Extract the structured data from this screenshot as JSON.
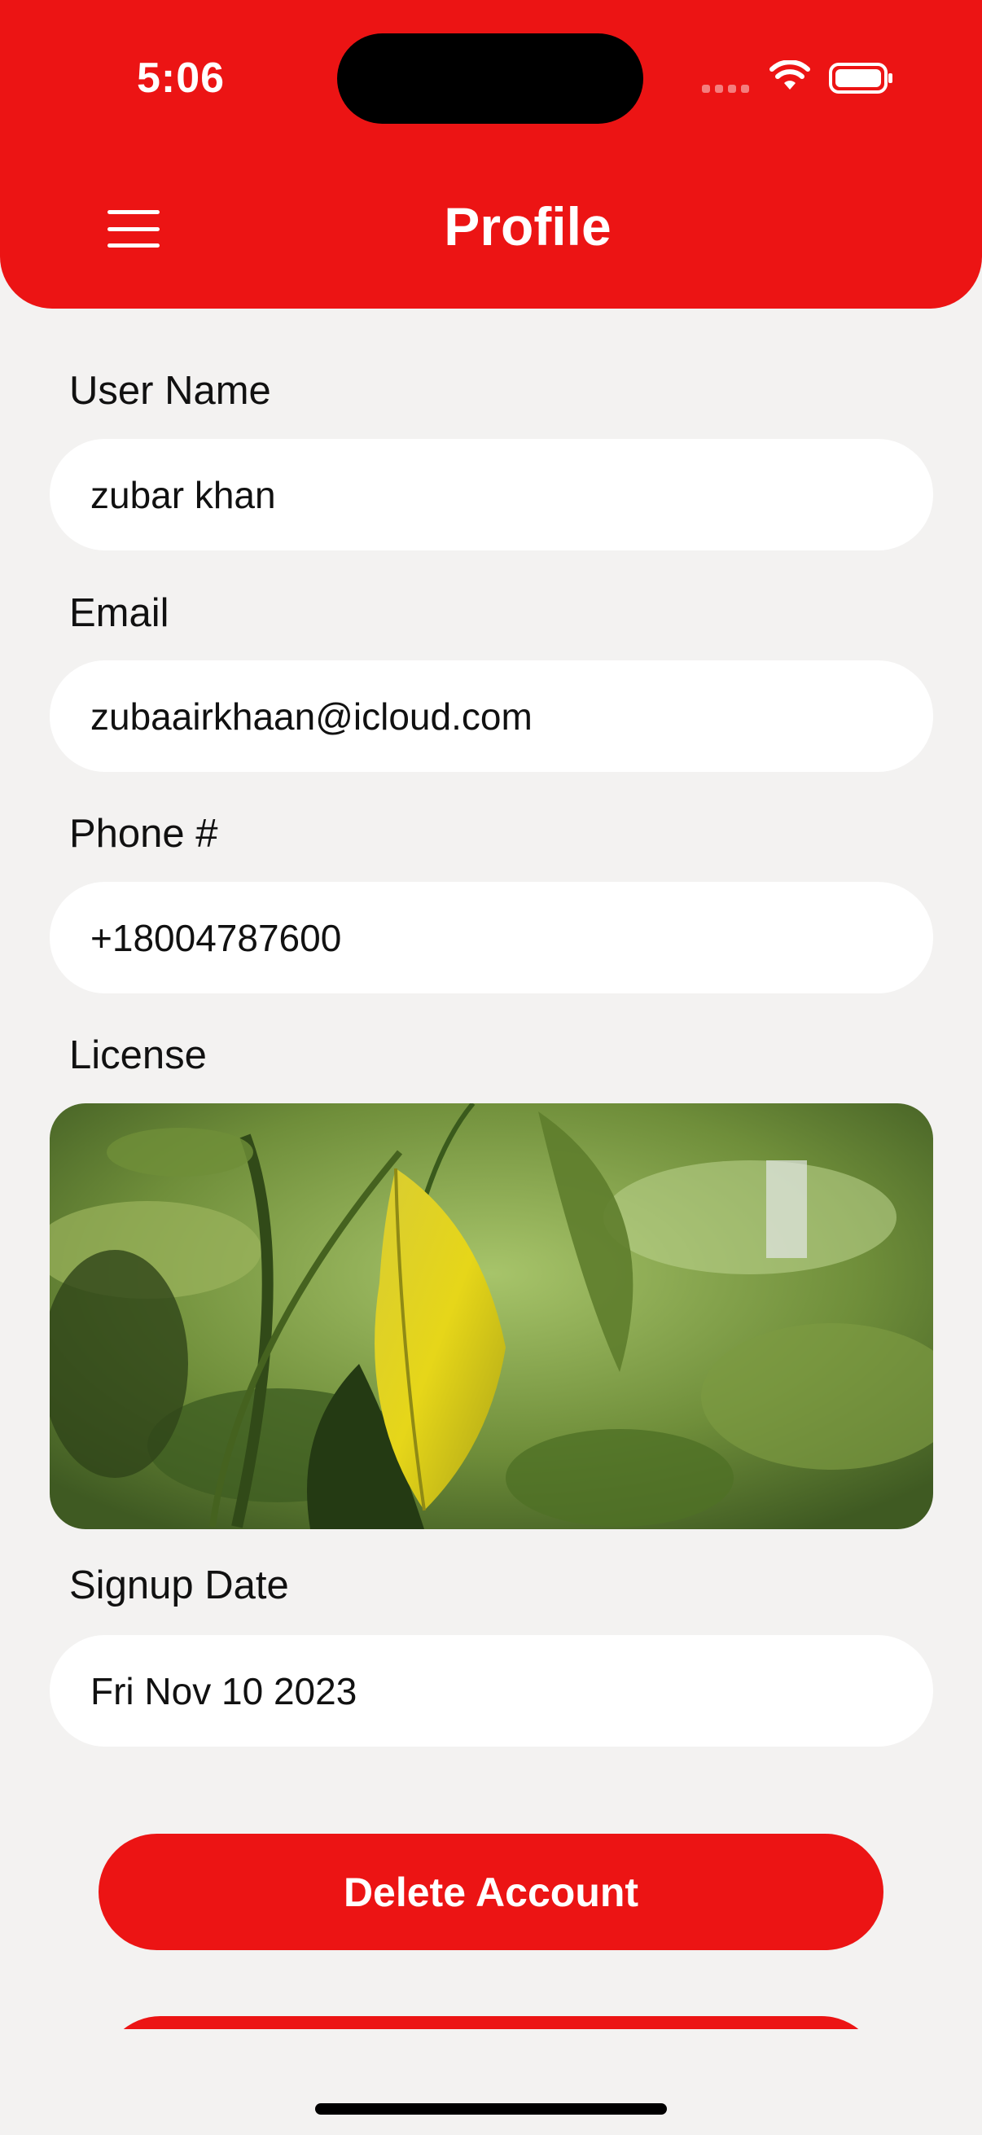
{
  "status_bar": {
    "time": "5:06"
  },
  "header": {
    "title": "Profile",
    "menu_icon": "hamburger-menu-icon",
    "background_color": "#ec1414"
  },
  "form": {
    "user_name": {
      "label": "User Name",
      "value": "zubar khan"
    },
    "email": {
      "label": "Email",
      "value": "zubaairkhaan@icloud.com"
    },
    "phone": {
      "label": "Phone #",
      "value": "+18004787600"
    },
    "license": {
      "label": "License",
      "image": "leaf-photo"
    },
    "signup_date": {
      "label": "Signup Date",
      "value": "Fri Nov 10 2023"
    }
  },
  "actions": {
    "delete_account": "Delete Account"
  }
}
